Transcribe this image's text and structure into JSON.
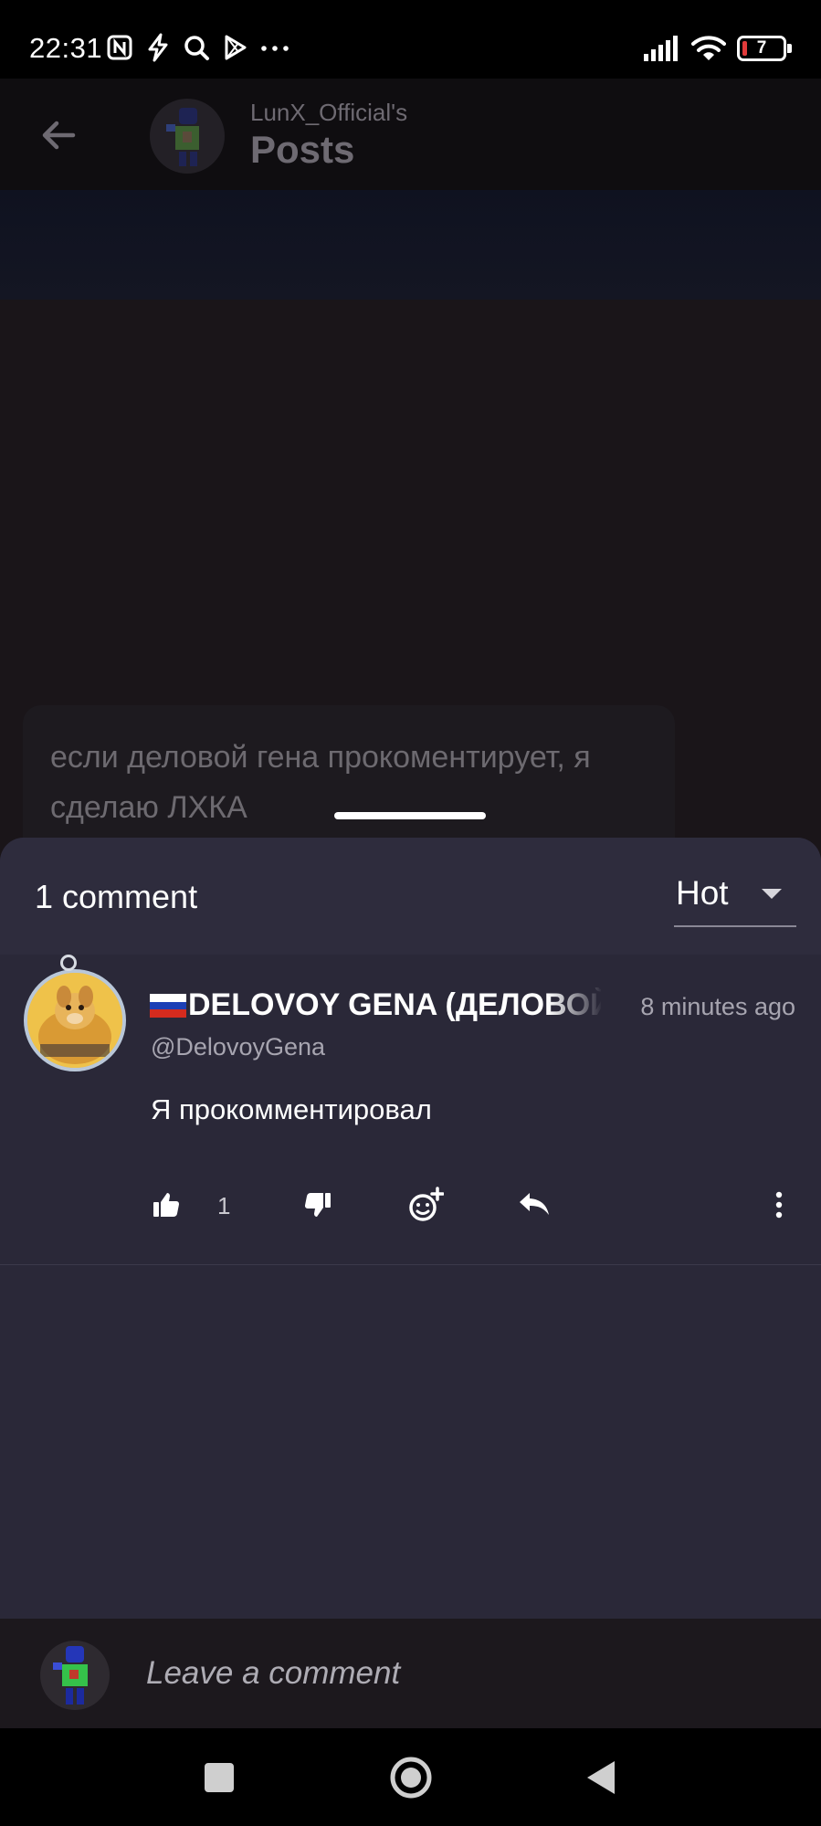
{
  "status_bar": {
    "time": "22:31",
    "battery_level": "7",
    "icons": [
      "nfc-icon",
      "bolt-icon",
      "search-icon",
      "play-store-icon",
      "more-dots-icon",
      "signal-icon",
      "wifi-icon",
      "battery-icon"
    ]
  },
  "header": {
    "owner": "LunX_Official's",
    "title": "Posts"
  },
  "post": {
    "text": "если деловой гена прокоментирует, я сделаю ЛХКА"
  },
  "comments_sheet": {
    "count_label": "1 comment",
    "sort": {
      "selected": "Hot"
    },
    "comments": [
      {
        "name": "DELOVOY GENA (ДЕЛОВОЙ ГЕНА)",
        "flag": "russia",
        "handle": "@DelovoyGena",
        "time": "8 minutes ago",
        "text": "Я прокомментировал",
        "likes": "1"
      }
    ]
  },
  "comment_input": {
    "placeholder": "Leave a comment"
  },
  "colors": {
    "sheet_bg": "#2a2838",
    "page_bg": "#1a1519",
    "text_primary": "#ffffff",
    "text_secondary": "#a7a5b0"
  }
}
